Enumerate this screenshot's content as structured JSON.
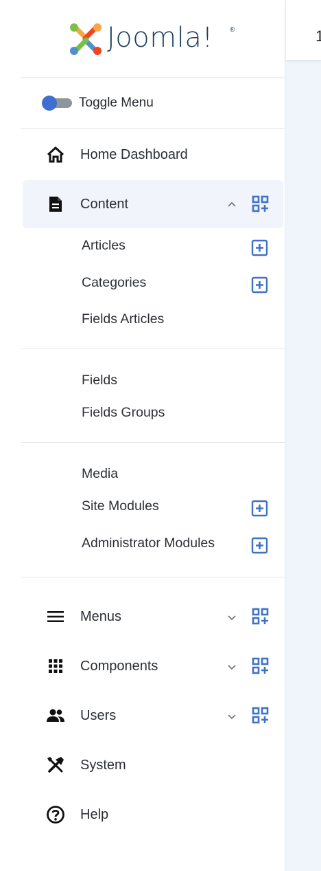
{
  "logo": {
    "text": "Joomla!",
    "reg": "®"
  },
  "topbar": {
    "fragment": "1"
  },
  "toggle": {
    "label": "Toggle Menu",
    "on": true
  },
  "nav": {
    "home": "Home Dashboard",
    "content": "Content",
    "menus": "Menus",
    "components": "Components",
    "users": "Users",
    "system": "System",
    "help": "Help"
  },
  "content_items": {
    "articles": "Articles",
    "categories": "Categories",
    "fields_articles": "Fields Articles",
    "fields": "Fields",
    "fields_groups": "Fields Groups",
    "media": "Media",
    "site_modules": "Site Modules",
    "admin_modules": "Administrator Modules"
  },
  "colors": {
    "accent": "#3e6fd0",
    "icon_blue": "#3f71c7",
    "toggle_track": "#8f959c"
  }
}
